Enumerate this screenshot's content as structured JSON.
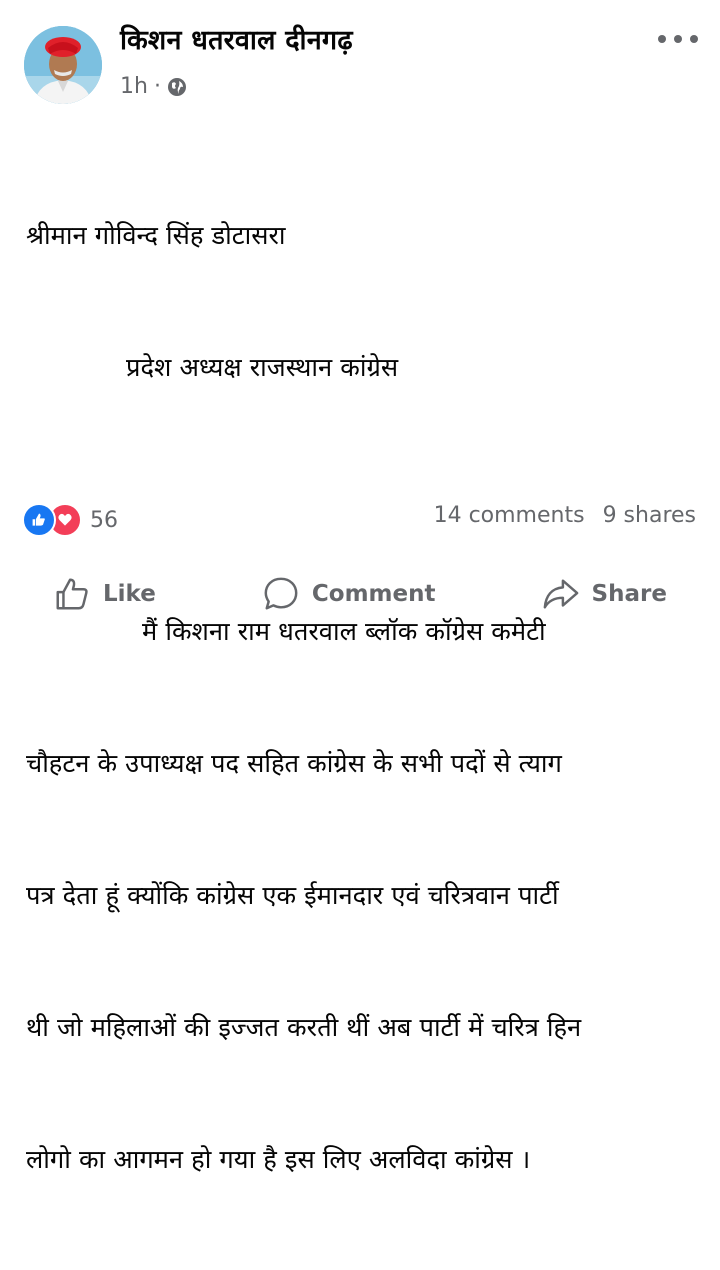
{
  "post": {
    "author_name": "किशन धतरवाल दीनगढ़",
    "time": "1h",
    "separator": "·",
    "privacy_icon": "globe-icon",
    "more_icon": "more-options-icon",
    "body_lines": [
      "श्रीमान गोविन्द सिंह डोटासरा",
      "प्रदेश अध्यक्ष राजस्थान कांग्रेस",
      "",
      "मैं किशना राम धतरवाल ब्लॉक कॉग्रेस कमेटी",
      "चौहटन के उपाध्यक्ष पद सहित कांग्रेस के सभी पदों से त्याग",
      "पत्र देता हूं क्योंकि कांग्रेस एक ईमानदार एवं चरित्रवान पार्टी",
      "थी जो महिलाओं की इज्जत करती थीं अब पार्टी में चरित्र हिन",
      "लोगो का आगमन हो गया है इस लिए अलविदा कांग्रेस ।"
    ]
  },
  "reactions": {
    "icons": [
      "like-reaction-icon",
      "love-reaction-icon"
    ],
    "count": "56",
    "comments": "14 comments",
    "shares": "9 shares"
  },
  "actions": {
    "like": "Like",
    "comment": "Comment",
    "share": "Share"
  },
  "colors": {
    "like_blue": "#1877f2",
    "love_red": "#f33e58",
    "secondary_text": "#65676b"
  }
}
